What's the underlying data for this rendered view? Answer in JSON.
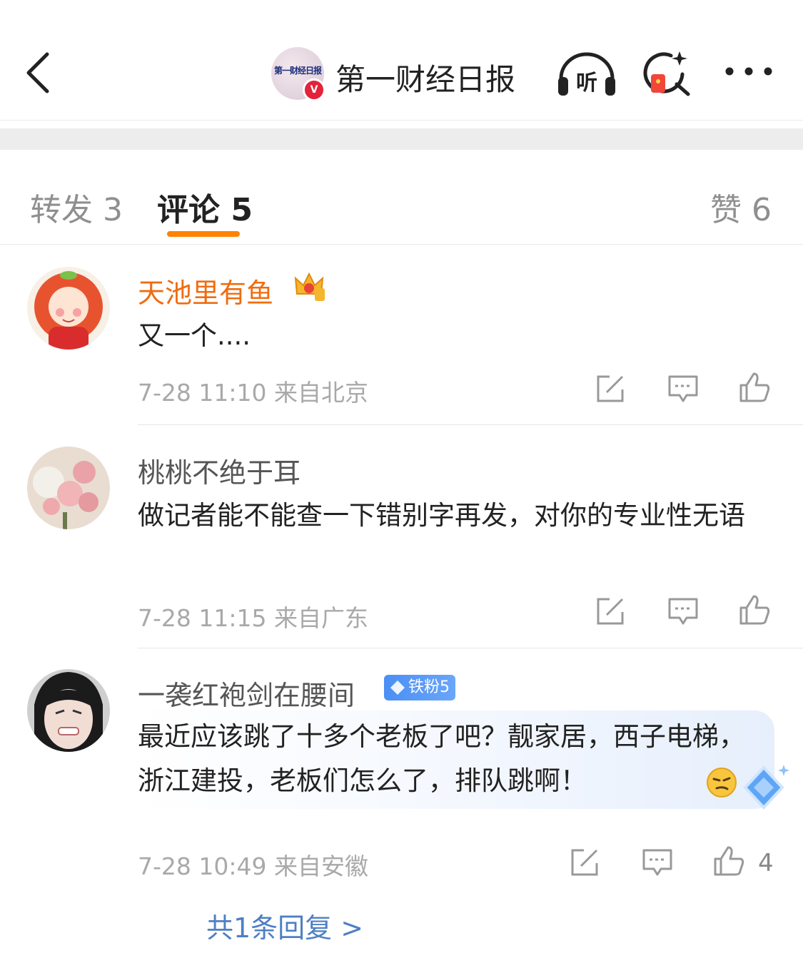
{
  "header": {
    "account_name": "第一财经日报",
    "listen_label": "听",
    "verified_mark": "V"
  },
  "tabs": {
    "repost": "转发 3",
    "comments": "评论 5",
    "likes": "赞 6"
  },
  "colors": {
    "accent": "#ff8200",
    "vip_name": "#f06c10",
    "link": "#4f7fc4",
    "fan_badge": "#4b8ff5"
  },
  "comments": [
    {
      "user": "天池里有鱼",
      "badge_icon": "crown-level-icon",
      "text": "又一个....",
      "time": "7-28 11:10",
      "location": "来自北京"
    },
    {
      "user": "桃桃不绝于耳",
      "text": "做记者能不能查一下错别字再发，对你的专业性无语",
      "time": "7-28 11:15",
      "location": "来自广东"
    },
    {
      "user": "一袭红袍剑在腰间",
      "fan_badge": "铁粉5",
      "text": "最近应该跳了十多个老板了吧？靓家居，西子电梯，浙江建投，老板们怎么了，排队跳啊！",
      "emoji": "thinking-emoji",
      "time": "7-28 10:49",
      "location": "来自安徽",
      "like_count": "4",
      "replies_link": "共1条回复 >"
    }
  ]
}
